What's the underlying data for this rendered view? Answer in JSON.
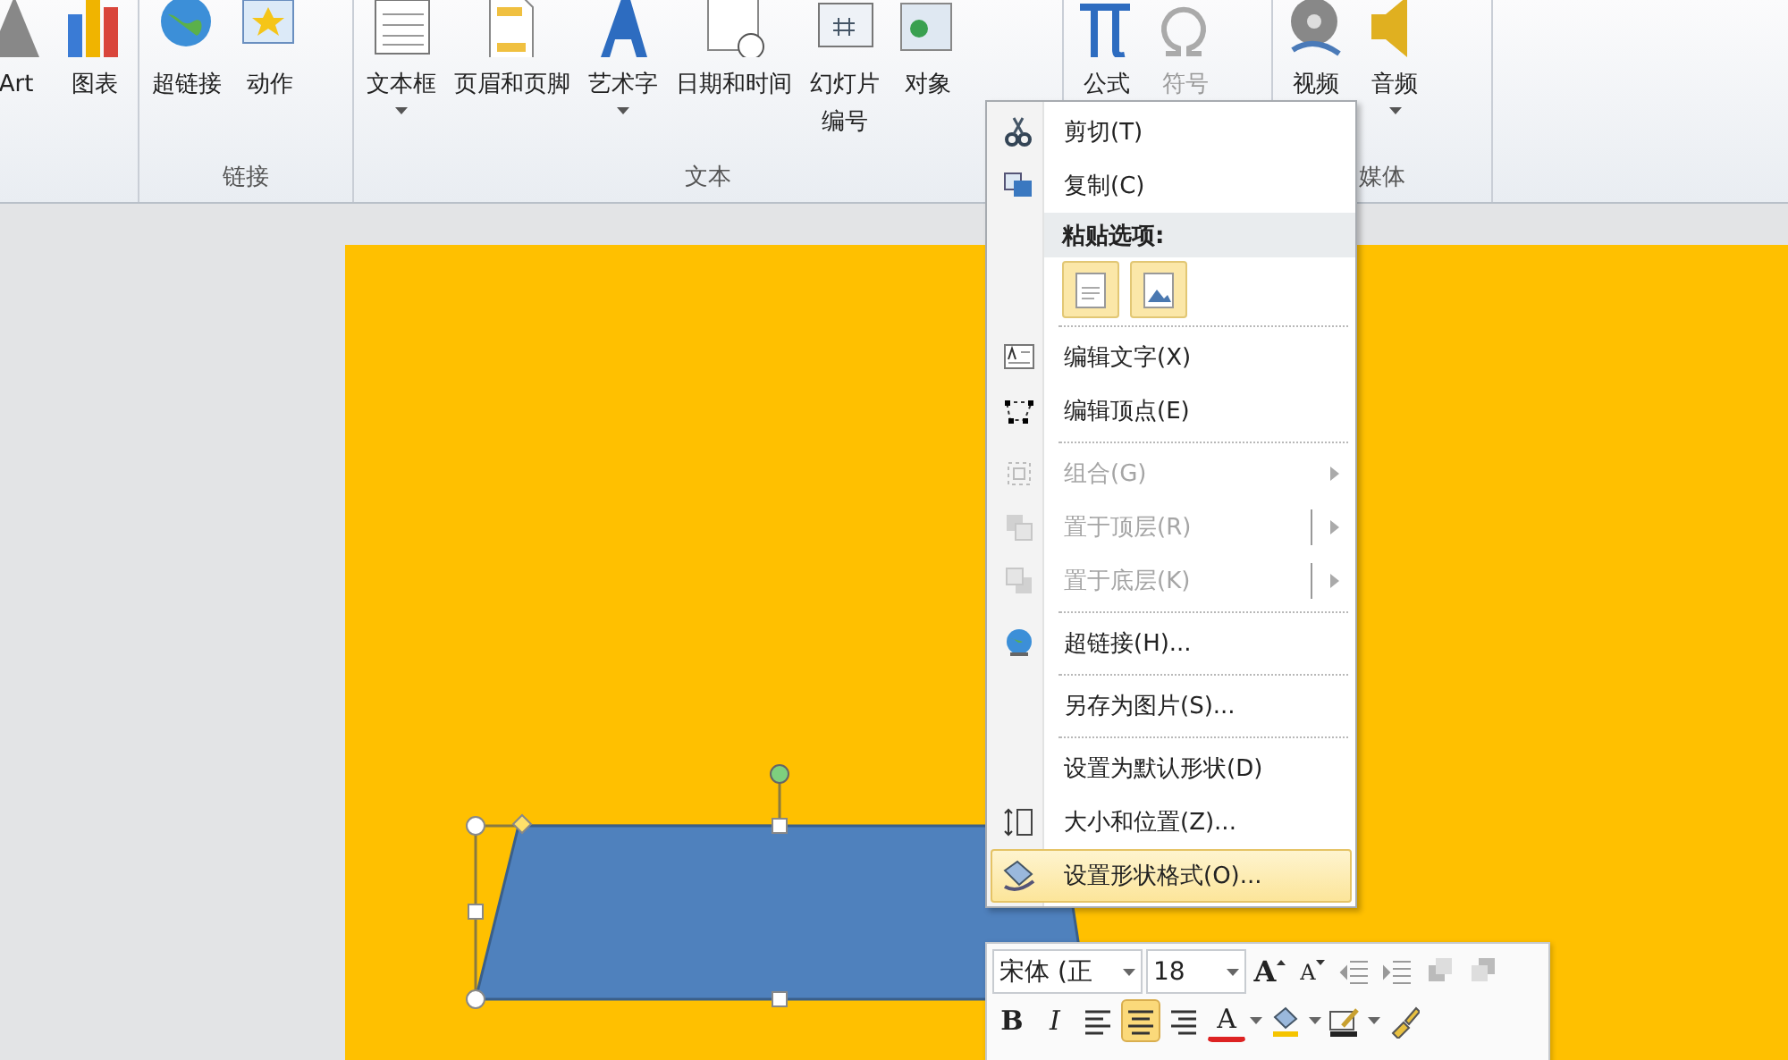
{
  "ribbon": {
    "groups": [
      {
        "buttons": [
          {
            "label": "Art",
            "dropdown": false
          },
          {
            "label": "图表",
            "dropdown": false
          }
        ]
      },
      {
        "label": "链接",
        "buttons": [
          {
            "label": "超链接",
            "dropdown": false
          },
          {
            "label": "动作",
            "dropdown": false
          }
        ]
      },
      {
        "label": "文本",
        "buttons": [
          {
            "label": "文本框",
            "dropdown": true
          },
          {
            "label": "页眉和页脚",
            "dropdown": false
          },
          {
            "label": "艺术字",
            "dropdown": true
          },
          {
            "label": "日期和时间",
            "dropdown": false
          },
          {
            "lines": [
              "幻灯片",
              "编号"
            ],
            "dropdown": false
          },
          {
            "label": "对象",
            "dropdown": false
          }
        ]
      },
      {
        "buttons": [
          {
            "label": "公式",
            "dropdown": false,
            "disabled": false
          },
          {
            "label": "符号",
            "dropdown": false,
            "disabled": true
          }
        ]
      },
      {
        "label": "媒体",
        "buttons": [
          {
            "label": "视频",
            "dropdown": false
          },
          {
            "label": "音频",
            "dropdown": true
          }
        ]
      }
    ]
  },
  "context_menu": {
    "items": [
      {
        "kind": "item",
        "label": "剪切(T)",
        "disabled": false,
        "selected": false
      },
      {
        "kind": "item",
        "label": "复制(C)",
        "disabled": false,
        "selected": false
      },
      {
        "kind": "header",
        "label": "粘贴选项:"
      },
      {
        "kind": "paste"
      },
      {
        "kind": "separator"
      },
      {
        "kind": "item",
        "label": "编辑文字(X)",
        "disabled": false,
        "selected": false
      },
      {
        "kind": "item",
        "label": "编辑顶点(E)",
        "disabled": false,
        "selected": false
      },
      {
        "kind": "separator"
      },
      {
        "kind": "item",
        "label": "组合(G)",
        "disabled": true,
        "selected": false,
        "submenu": true,
        "split": false
      },
      {
        "kind": "item",
        "label": "置于顶层(R)",
        "disabled": true,
        "selected": false,
        "submenu": true,
        "split": true
      },
      {
        "kind": "item",
        "label": "置于底层(K)",
        "disabled": true,
        "selected": false,
        "submenu": true,
        "split": true
      },
      {
        "kind": "separator"
      },
      {
        "kind": "item",
        "label": "超链接(H)...",
        "disabled": false,
        "selected": false
      },
      {
        "kind": "separator"
      },
      {
        "kind": "item",
        "label": "另存为图片(S)...",
        "disabled": false,
        "selected": false
      },
      {
        "kind": "separator"
      },
      {
        "kind": "item",
        "label": "设置为默认形状(D)",
        "disabled": false,
        "selected": false
      },
      {
        "kind": "item",
        "label": "大小和位置(Z)...",
        "disabled": false,
        "selected": false
      },
      {
        "kind": "item",
        "label": "设置形状格式(O)...",
        "disabled": false,
        "selected": true
      }
    ]
  },
  "mini_toolbar": {
    "font": "宋体 (正",
    "size": "18",
    "row1": [
      {
        "kind": "grow",
        "label": "A"
      },
      {
        "kind": "shrink",
        "label": "A"
      },
      {
        "kind": "outdent"
      },
      {
        "kind": "indent"
      },
      {
        "kind": "forward"
      },
      {
        "kind": "backward"
      }
    ],
    "row2": [
      {
        "kind": "bold",
        "label": "B"
      },
      {
        "kind": "italic",
        "label": "I"
      },
      {
        "kind": "align-left",
        "selected": false
      },
      {
        "kind": "align-center",
        "selected": true
      },
      {
        "kind": "align-right",
        "selected": false
      },
      {
        "kind": "font-color",
        "label": "A"
      },
      {
        "kind": "fill"
      },
      {
        "kind": "outline"
      },
      {
        "kind": "painter"
      }
    ]
  }
}
